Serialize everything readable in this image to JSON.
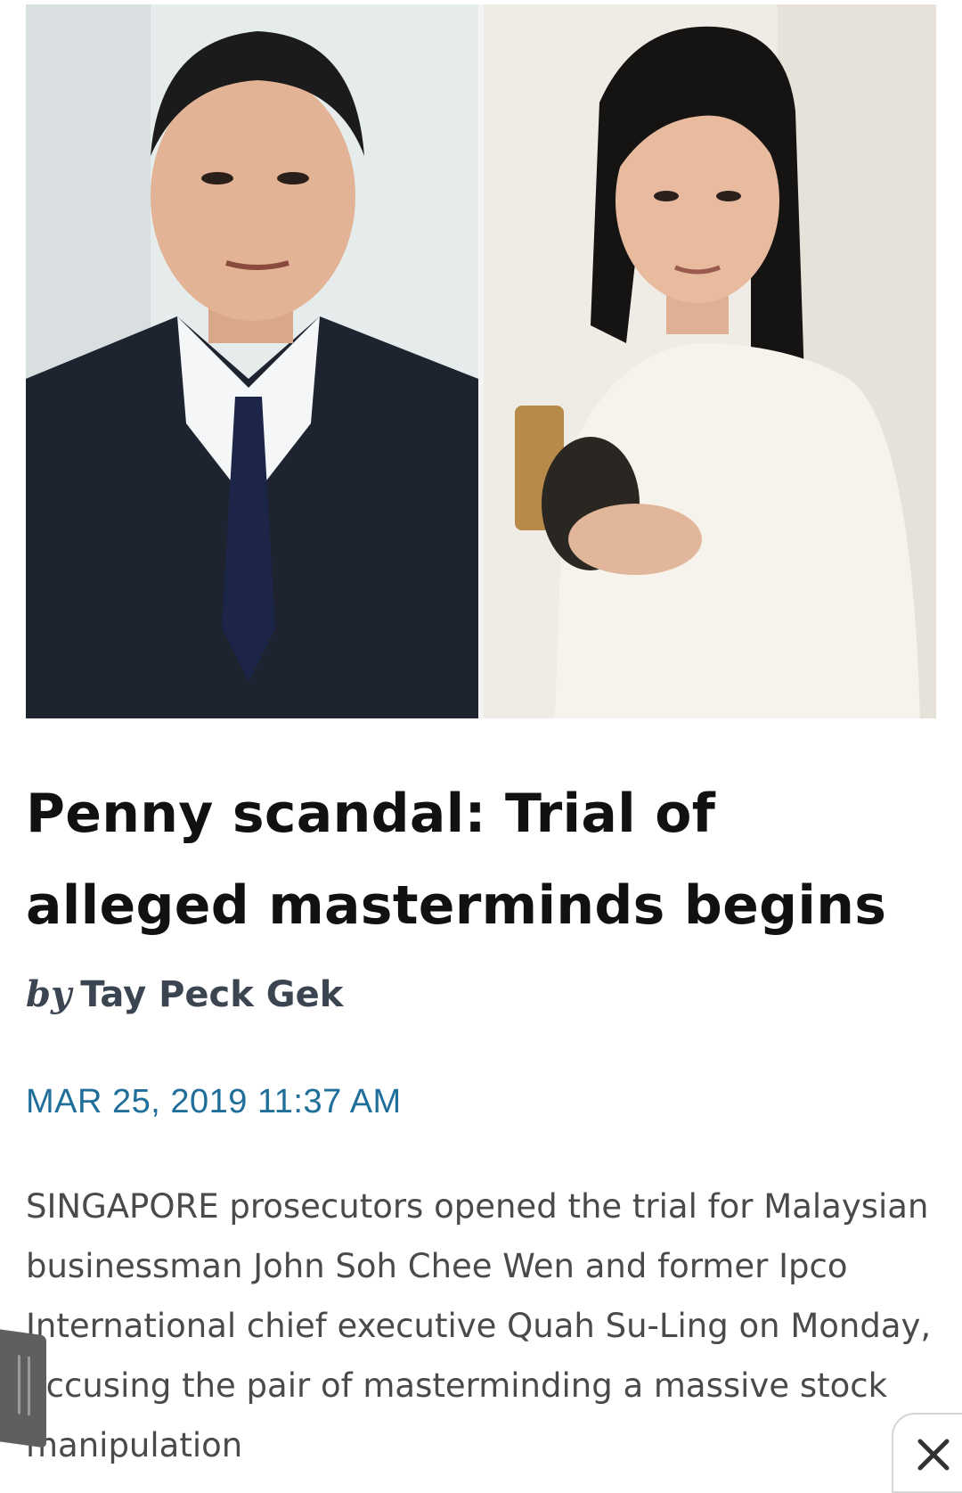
{
  "article": {
    "headline": "Penny scandal: Trial of alleged masterminds begins",
    "byline_prefix": "by",
    "author": "Tay Peck Gek",
    "dateline": "MAR 25, 2019 11:37 AM",
    "body": "SINGAPORE prosecutors opened the trial for Malaysian businessman John Soh Chee Wen and former Ipco International chief executive Quah Su-Ling on Monday, accusing the pair of masterminding a massive stock manipulation"
  },
  "icons": {
    "close": "close-icon",
    "handle": "drag-handle-icon"
  },
  "colors": {
    "headline": "#111111",
    "byline": "#3b4551",
    "dateline": "#1f6f9a",
    "body": "#4a4a4a",
    "handle": "#5f5f5f"
  }
}
